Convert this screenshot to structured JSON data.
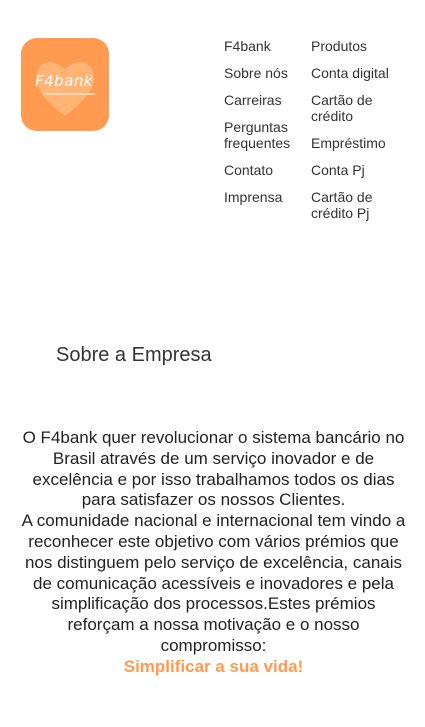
{
  "logo": {
    "text": "F4bank",
    "color": "#ff9a50"
  },
  "nav": {
    "col1": [
      "F4bank",
      "Sobre nós",
      "Carreiras",
      "Perguntas frequentes",
      "Contato",
      "Imprensa"
    ],
    "col2": [
      "Produtos",
      "Conta digital",
      "Cartão de crédito",
      "Empréstimo",
      "Conta Pj",
      "Cartão de crédito Pj"
    ]
  },
  "about": {
    "title": "Sobre a Empresa",
    "paragraph1": "O F4bank quer revolucionar o sistema bancário no Brasil através de um serviço inovador e de excelência e por isso trabalhamos todos os dias para satisfazer os nossos Clientes.",
    "paragraph2": "A comunidade nacional e internacional tem vindo a reconhecer este objetivo com vários prémios que nos distinguem pelo serviço de excelência, canais de comunicação acessíveis e inovadores e pela simplificação dos processos.Estes prémios reforçam a nossa motivação e o nosso compromisso:",
    "tagline": "Simplificar a sua vida!",
    "accent_color": "#ff9a50"
  }
}
